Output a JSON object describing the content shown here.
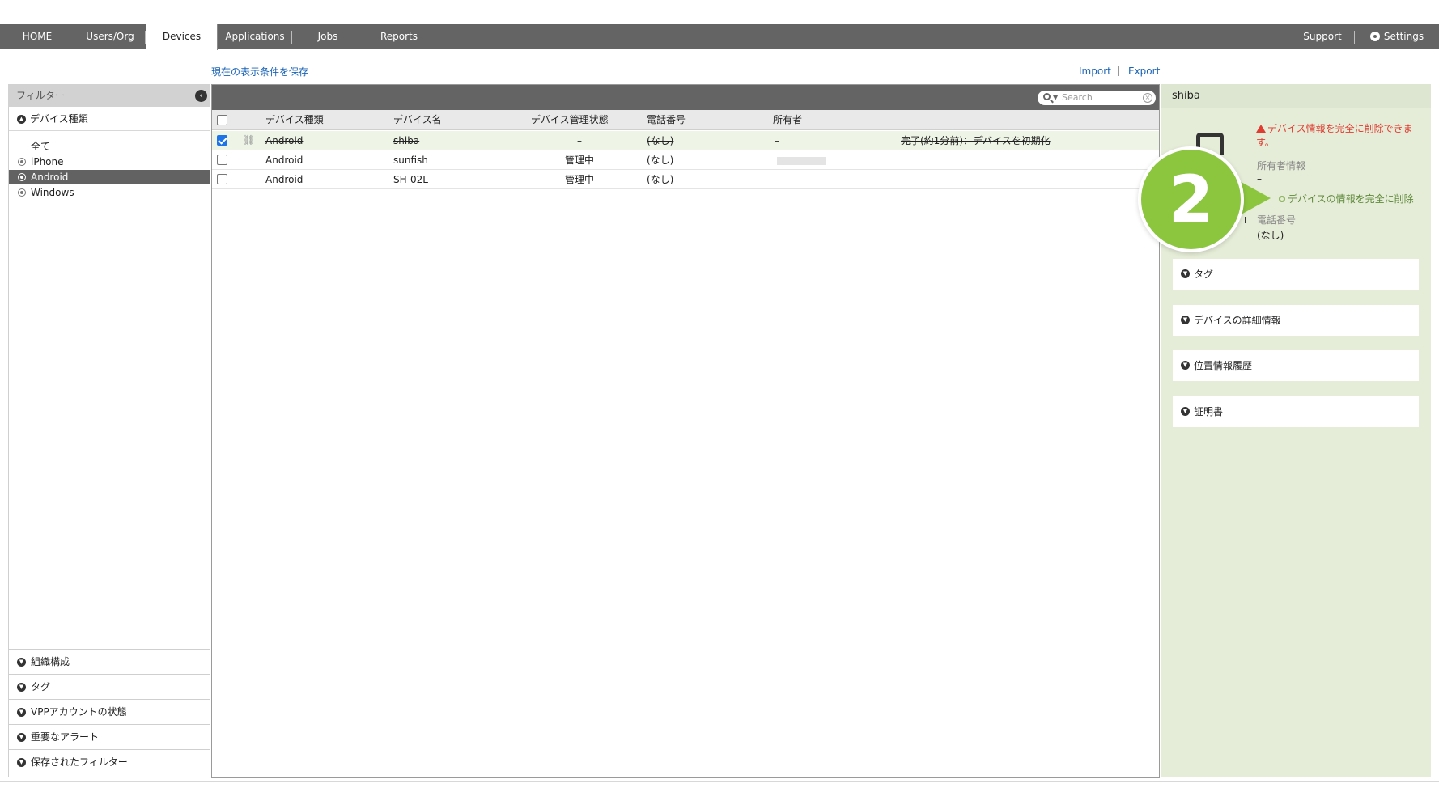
{
  "nav": {
    "tabs": [
      "HOME",
      "Users/Org",
      "Devices",
      "Applications",
      "Jobs",
      "Reports"
    ],
    "active_tab": "Devices",
    "support": "Support",
    "settings": "Settings"
  },
  "toolbar": {
    "save_view": "現在の表示条件を保存",
    "import": "Import",
    "pipe": "|",
    "export": "Export"
  },
  "filter": {
    "title": "フィルター",
    "device_type_section": "デバイス種類",
    "options": [
      "全て",
      "iPhone",
      "Android",
      "Windows"
    ],
    "selected": "Android",
    "bottom_sections": [
      "組織構成",
      "タグ",
      "VPPアカウントの状態",
      "重要なアラート",
      "保存されたフィルター"
    ]
  },
  "table": {
    "search_placeholder": "Search",
    "columns": [
      "デバイス種類",
      "デバイス名",
      "デバイス管理状態",
      "電話番号",
      "所有者"
    ],
    "rows": [
      {
        "type": "Android",
        "name": "shiba",
        "status": "–",
        "phone": "(なし)",
        "owner": "–",
        "note": "完了(約1分前)：デバイスを初期化",
        "checked": true,
        "struck": true
      },
      {
        "type": "Android",
        "name": "sunfish",
        "status": "管理中",
        "phone": "(なし)",
        "owner": "",
        "note": "",
        "checked": false,
        "struck": false
      },
      {
        "type": "Android",
        "name": "SH-02L",
        "status": "管理中",
        "phone": "(なし)",
        "owner": "",
        "note": "",
        "checked": false,
        "struck": false
      }
    ]
  },
  "detail": {
    "device_name": "shiba",
    "warning": "デバイス情報を完全に削除できます。",
    "owner_label": "所有者情報",
    "owner_value": "–",
    "delete_action": "デバイスの情報を完全に削除",
    "phone_label": "電話番号",
    "phone_value": "(なし)",
    "sections": [
      "タグ",
      "デバイスの詳細情報",
      "位置情報履歴",
      "証明書"
    ]
  },
  "callout": {
    "number": "2",
    "color": "#8cc63f"
  },
  "colors": {
    "nav_bg": "#646464",
    "link": "#1a63b5",
    "warning": "#e03c31",
    "detail_bg": "#e5ecd7",
    "selected_row": "#eef4e6"
  }
}
